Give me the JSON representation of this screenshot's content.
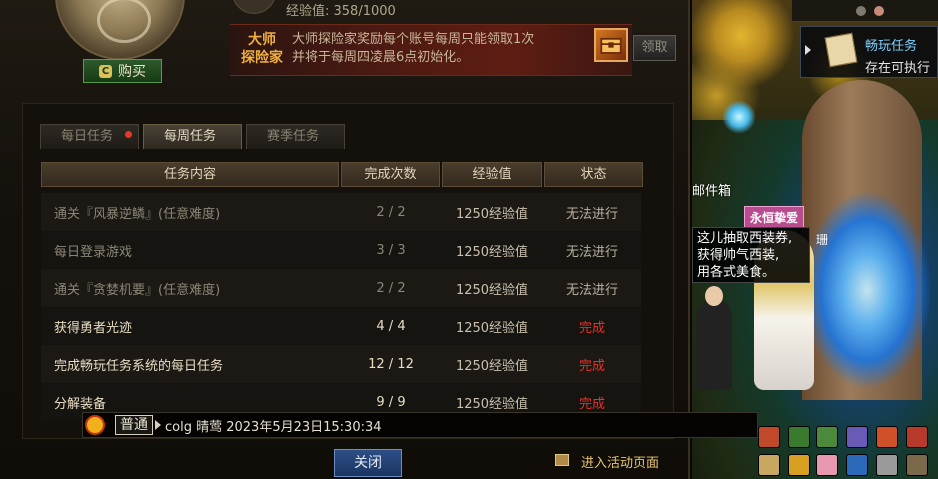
{
  "header": {
    "exp_text": "经验值: 358/1000",
    "buy_label": "购买",
    "buy_icon": "C"
  },
  "banner": {
    "tag_line1": "大师",
    "tag_line2": "探险家",
    "desc_line1": "大师探险家奖励每个账号每周只能领取1次",
    "desc_line2": "并将于每周四凌晨6点初始化。",
    "claim_label": "领取"
  },
  "tabs": [
    {
      "label": "每日任务",
      "active": false,
      "alert": true
    },
    {
      "label": "每周任务",
      "active": true,
      "alert": false
    },
    {
      "label": "赛季任务",
      "active": false,
      "alert": false
    }
  ],
  "table": {
    "columns": [
      "任务内容",
      "完成次数",
      "经验值",
      "状态"
    ],
    "rows": [
      {
        "task": "通关『风暴逆鳞』(任意难度)",
        "count": "2 / 2",
        "exp": "1250经验值",
        "status": "无法进行",
        "done": false
      },
      {
        "task": "每日登录游戏",
        "count": "3 / 3",
        "exp": "1250经验值",
        "status": "无法进行",
        "done": false
      },
      {
        "task": "通关『贪婪机要』(任意难度)",
        "count": "2 / 2",
        "exp": "1250经验值",
        "status": "无法进行",
        "done": false
      },
      {
        "task": "获得勇者光迹",
        "count": "4 / 4",
        "exp": "1250经验值",
        "status": "完成",
        "done": true
      },
      {
        "task": "完成畅玩任务系统的每日任务",
        "count": "12 / 12",
        "exp": "1250经验值",
        "status": "完成",
        "done": true
      },
      {
        "task": "分解装备",
        "count": "9 / 9",
        "exp": "1250经验值",
        "status": "完成",
        "done": true
      }
    ]
  },
  "chat": {
    "channel": "普通",
    "message": "colg 晴莺 2023年5月23日15:30:34"
  },
  "footer": {
    "close_label": "关闭",
    "activity_link": "进入活动页面"
  },
  "scene": {
    "quest_title": "畅玩任务",
    "quest_status": "存在可执行",
    "mailbox_label": "邮件箱",
    "npc_tag": "永恒挚爱",
    "npc_name": "珊",
    "speech_lines": [
      "这儿抽取西装券,",
      "获得帅气西装,",
      "用各式美食。"
    ]
  },
  "colors": {
    "accent_gold": "#e8c66b",
    "complete_red": "#e8312a",
    "quest_blue": "#7ed0ff"
  }
}
